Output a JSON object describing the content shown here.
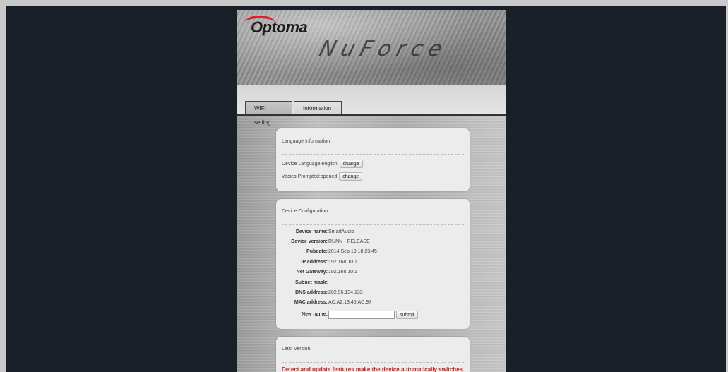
{
  "brand": {
    "logo": "Optoma",
    "product": "NuForce"
  },
  "tabs": [
    {
      "label": "WIFI setting"
    },
    {
      "label": "Information"
    }
  ],
  "language_panel": {
    "title": "Language Information",
    "device_language": {
      "label": "Device Language:english",
      "button": "change"
    },
    "voices_prompted": {
      "label": "Vocies Prompted:opened",
      "button": "change"
    }
  },
  "config_panel": {
    "title": "Device Configuration",
    "rows": [
      {
        "label": "Device name:",
        "value": "SmartAudio"
      },
      {
        "label": "Device version:",
        "value": "RUNN - RELEASE"
      },
      {
        "label": "Pubdate:",
        "value": "2014 Sep 19 18:23:45"
      },
      {
        "label": "IP address:",
        "value": "192.168.10.1"
      },
      {
        "label": "Net Gateway:",
        "value": "192.168.10.1"
      },
      {
        "label": "Subnet mask:",
        "value": ""
      },
      {
        "label": "DNS address:",
        "value": "202.96.134.133"
      },
      {
        "label": "MAC address:",
        "value": "AC:A2:13:45:AC:97"
      }
    ],
    "new_name": {
      "label": "New name:",
      "value": "",
      "button": "submit"
    }
  },
  "latest_panel": {
    "title": "Latst Version",
    "message": "Detect and update features make the device automatically switches"
  }
}
